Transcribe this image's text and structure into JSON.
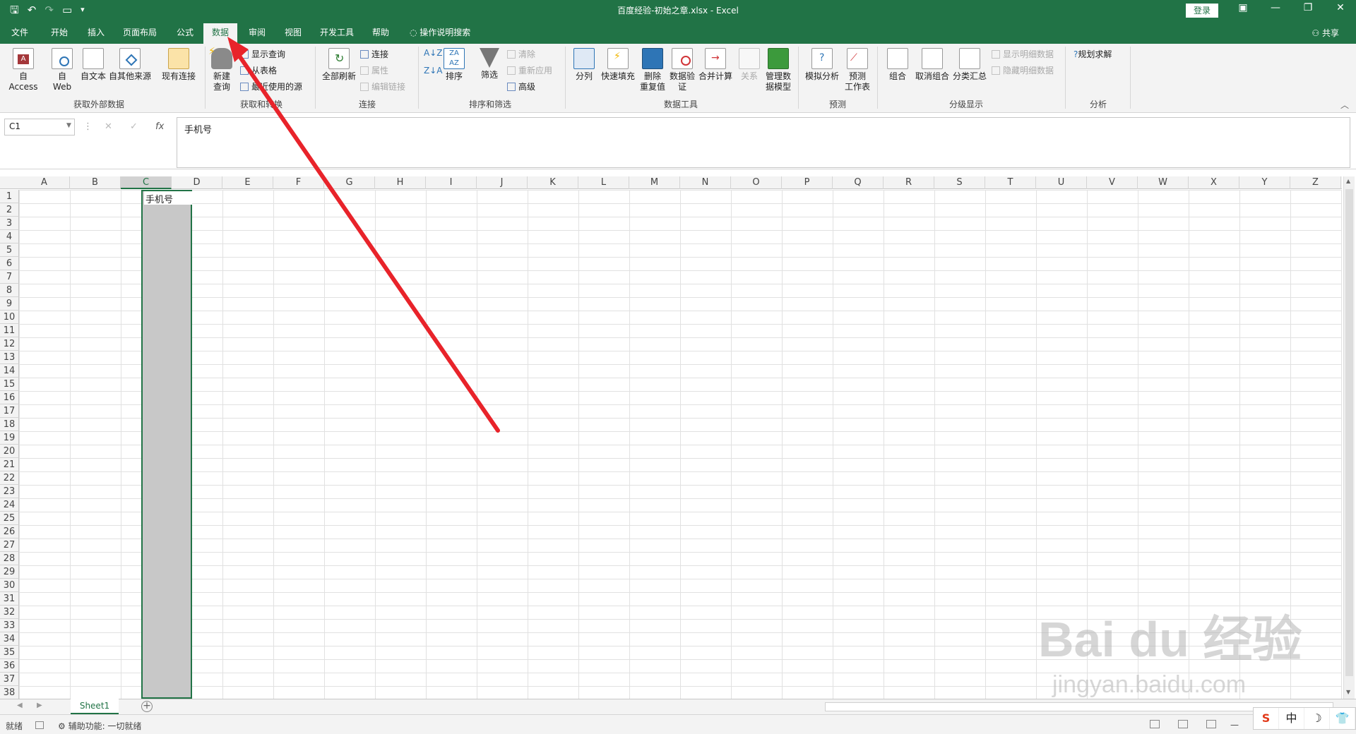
{
  "window": {
    "title": "百度经验-初始之章.xlsx  -  Excel",
    "login_label": "登录",
    "minimize": "—",
    "maximize": "❐",
    "close": "✕",
    "ribbon_display": "▣"
  },
  "qat": {
    "save": "🖫",
    "undo": "↶",
    "redo": "↷",
    "touch": "▭",
    "more": "▾"
  },
  "tabs": [
    "文件",
    "开始",
    "插入",
    "页面布局",
    "公式",
    "数据",
    "审阅",
    "视图",
    "开发工具",
    "帮助"
  ],
  "active_tab": "数据",
  "tell_me": "操作说明搜索",
  "share": "共享",
  "ribbon": {
    "get_external": {
      "group_label": "获取外部数据",
      "access": "自 Access",
      "web_line1": "自",
      "web_line2": "Web",
      "text": "自文本",
      "other": "自其他来源",
      "existing": "现有连接"
    },
    "get_transform": {
      "group_label": "获取和转换",
      "new_query_line1": "新建",
      "new_query_line2": "查询",
      "show_queries": "显示查询",
      "from_table": "从表格",
      "recent_sources": "最近使用的源"
    },
    "connections": {
      "group_label": "连接",
      "refresh_all": "全部刷新",
      "connections": "连接",
      "properties": "属性",
      "edit_links": "编辑链接"
    },
    "sort_filter": {
      "group_label": "排序和筛选",
      "sort": "排序",
      "filter": "筛选",
      "clear": "清除",
      "reapply": "重新应用",
      "advanced": "高级"
    },
    "data_tools": {
      "group_label": "数据工具",
      "text_to_columns": "分列",
      "flash_fill": "快速填充",
      "remove_dup_line1": "删除",
      "remove_dup_line2": "重复值",
      "validation_line1": "数据验",
      "validation_line2": "证",
      "consolidate": "合并计算",
      "relationships": "关系",
      "manage_model_line1": "管理数",
      "manage_model_line2": "据模型"
    },
    "forecast": {
      "group_label": "预测",
      "what_if": "模拟分析",
      "forecast_line1": "预测",
      "forecast_line2": "工作表"
    },
    "outline": {
      "group_label": "分级显示",
      "group": "组合",
      "ungroup": "取消组合",
      "subtotal": "分类汇总",
      "show_detail": "显示明细数据",
      "hide_detail": "隐藏明细数据"
    },
    "analysis": {
      "group_label": "分析",
      "solver": "规划求解"
    }
  },
  "formula_bar": {
    "name_box": "C1",
    "cancel": "✕",
    "enter": "✓",
    "fx": "fx",
    "content": "手机号"
  },
  "columns": [
    "A",
    "B",
    "C",
    "D",
    "E",
    "F",
    "G",
    "H",
    "I",
    "J",
    "K",
    "L",
    "M",
    "N",
    "O",
    "P",
    "Q",
    "R",
    "S",
    "T",
    "U",
    "V",
    "W",
    "X",
    "Y",
    "Z"
  ],
  "selected_column": "C",
  "rows": [
    "1",
    "2",
    "3",
    "4",
    "5",
    "6",
    "7",
    "8",
    "9",
    "10",
    "11",
    "12",
    "13",
    "14",
    "15",
    "16",
    "17",
    "18",
    "19",
    "20",
    "21",
    "22",
    "23",
    "24",
    "25",
    "26",
    "27",
    "28",
    "29",
    "30",
    "31",
    "32",
    "33",
    "34",
    "35",
    "36",
    "37",
    "38"
  ],
  "cells": {
    "C1": "手机号"
  },
  "sheet_tabs": [
    "Sheet1"
  ],
  "status": {
    "ready": "就绪",
    "accessibility": "辅助功能: 一切就绪"
  },
  "ime": {
    "sogou": "S",
    "lang": "中",
    "moon": "☽",
    "shirt": "👕"
  },
  "watermark": {
    "logo": "Bai du 经验",
    "url": "jingyan.baidu.com"
  },
  "colors": {
    "excel_green": "#217346",
    "arrow": "#e8232a"
  }
}
